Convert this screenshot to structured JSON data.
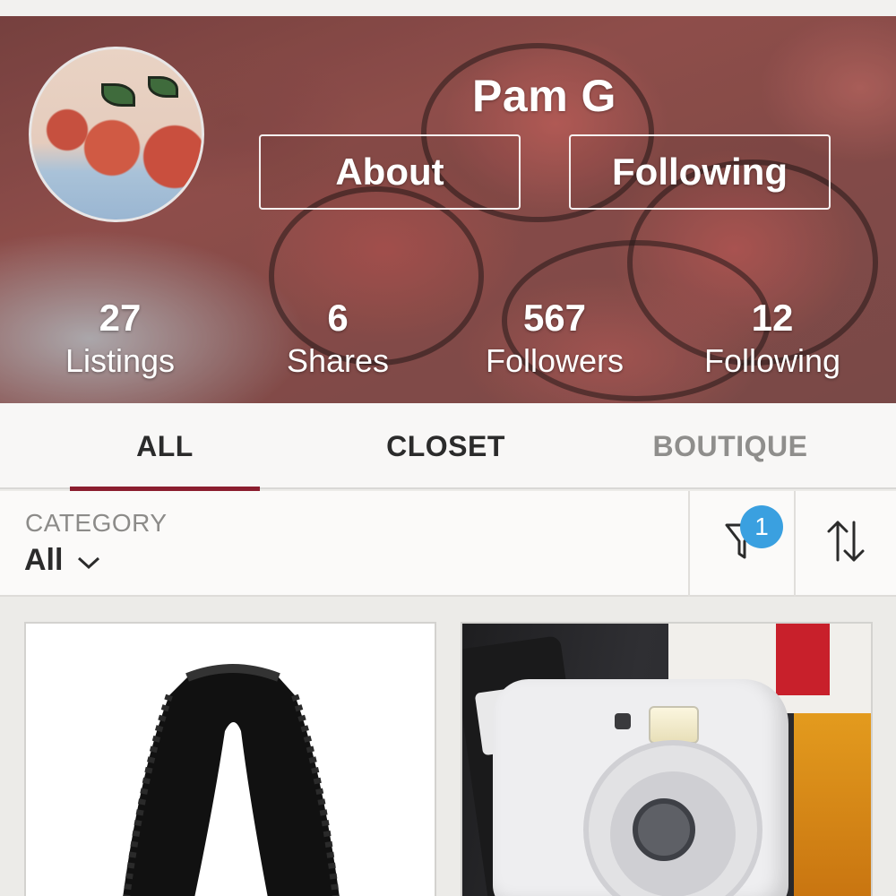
{
  "profile": {
    "name": "Pam G",
    "about_label": "About",
    "following_button_label": "Following"
  },
  "stats": [
    {
      "value": "27",
      "label": "Listings"
    },
    {
      "value": "6",
      "label": "Shares"
    },
    {
      "value": "567",
      "label": "Followers"
    },
    {
      "value": "12",
      "label": "Following"
    }
  ],
  "tabs": [
    {
      "label": "ALL",
      "active": true
    },
    {
      "label": "CLOSET",
      "active": false
    },
    {
      "label": "BOUTIQUE",
      "active": false
    }
  ],
  "filter": {
    "category_label": "CATEGORY",
    "category_value": "All",
    "filter_badge": "1",
    "filter_icon": "filter-icon",
    "sort_icon": "sort-icon"
  },
  "listings": [
    {
      "image": "black lace bralette"
    },
    {
      "image": "instax camera"
    }
  ],
  "colors": {
    "accent": "#8b1e2f",
    "badge": "#3aa0e0",
    "inactive_tab": "#8f8e8c"
  }
}
